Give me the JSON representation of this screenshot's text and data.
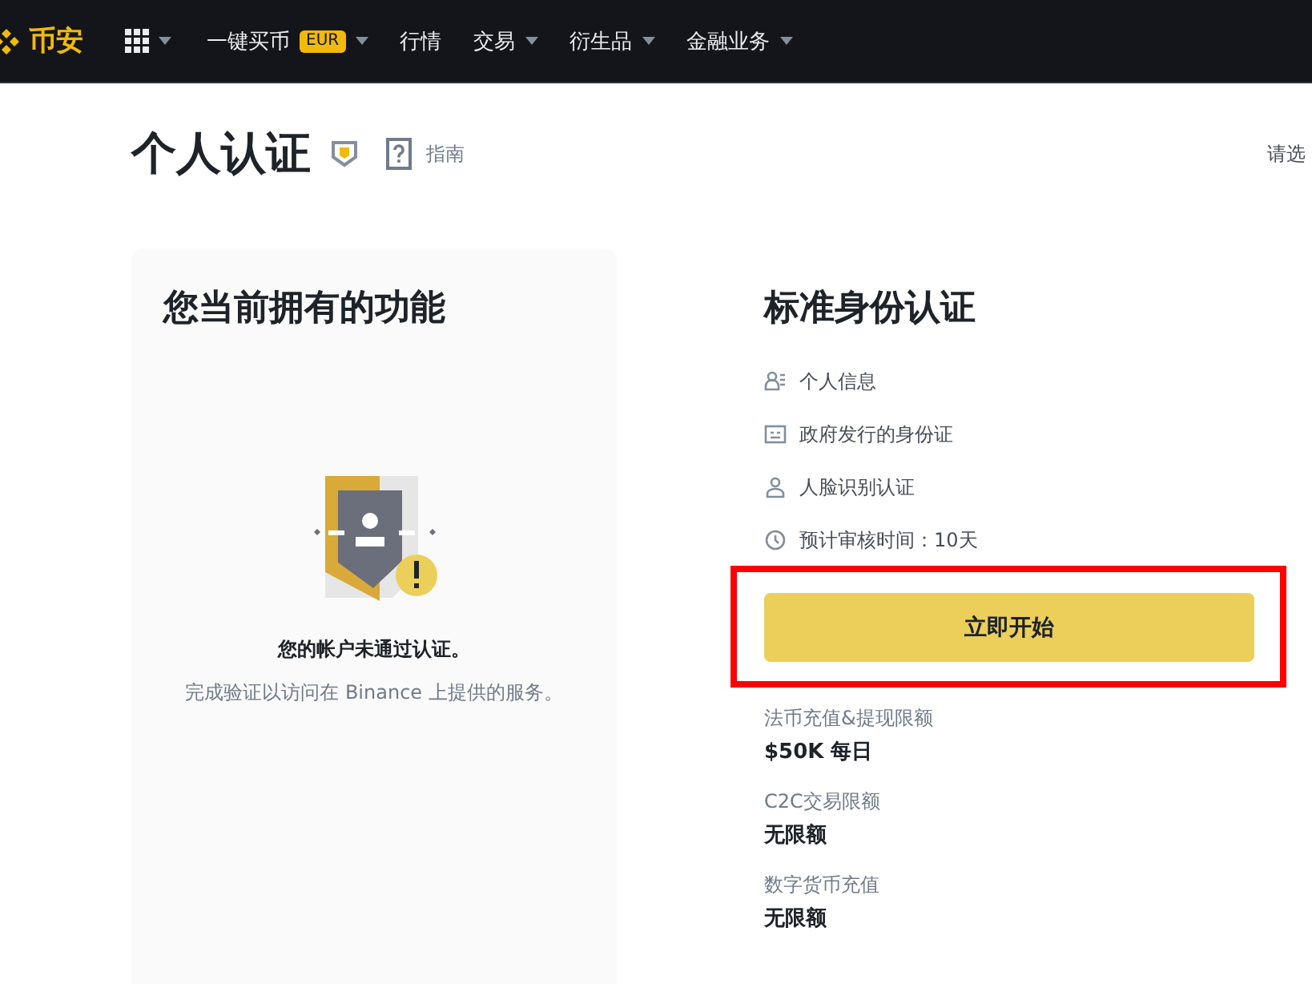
{
  "nav": {
    "logo_text": "币安",
    "items": [
      {
        "label": "一键买币",
        "badge": "EUR",
        "dropdown": true
      },
      {
        "label": "行情",
        "dropdown": false
      },
      {
        "label": "交易",
        "dropdown": true
      },
      {
        "label": "衍生品",
        "dropdown": true
      },
      {
        "label": "金融业务",
        "dropdown": true
      }
    ]
  },
  "header": {
    "title": "个人认证",
    "guide": "指南",
    "right_text": "请选"
  },
  "features_card": {
    "title": "您当前拥有的功能",
    "status": "您的帐户未通过认证。",
    "hint": "完成验证以访问在 Binance 上提供的服务。"
  },
  "verification": {
    "title": "标准身份认证",
    "requirements": [
      {
        "kind": "person-info",
        "text": "个人信息"
      },
      {
        "kind": "id-card",
        "text": "政府发行的身份证"
      },
      {
        "kind": "face",
        "text": "人脸识别认证"
      },
      {
        "kind": "clock",
        "text": "预计审核时间：10天"
      }
    ],
    "start_button": "立即开始",
    "limits": [
      {
        "label": "法币充值&提现限额",
        "value": "$50K 每日"
      },
      {
        "label": "C2C交易限额",
        "value": "无限额"
      },
      {
        "label": "数字货币充值",
        "value": "无限额"
      }
    ]
  }
}
